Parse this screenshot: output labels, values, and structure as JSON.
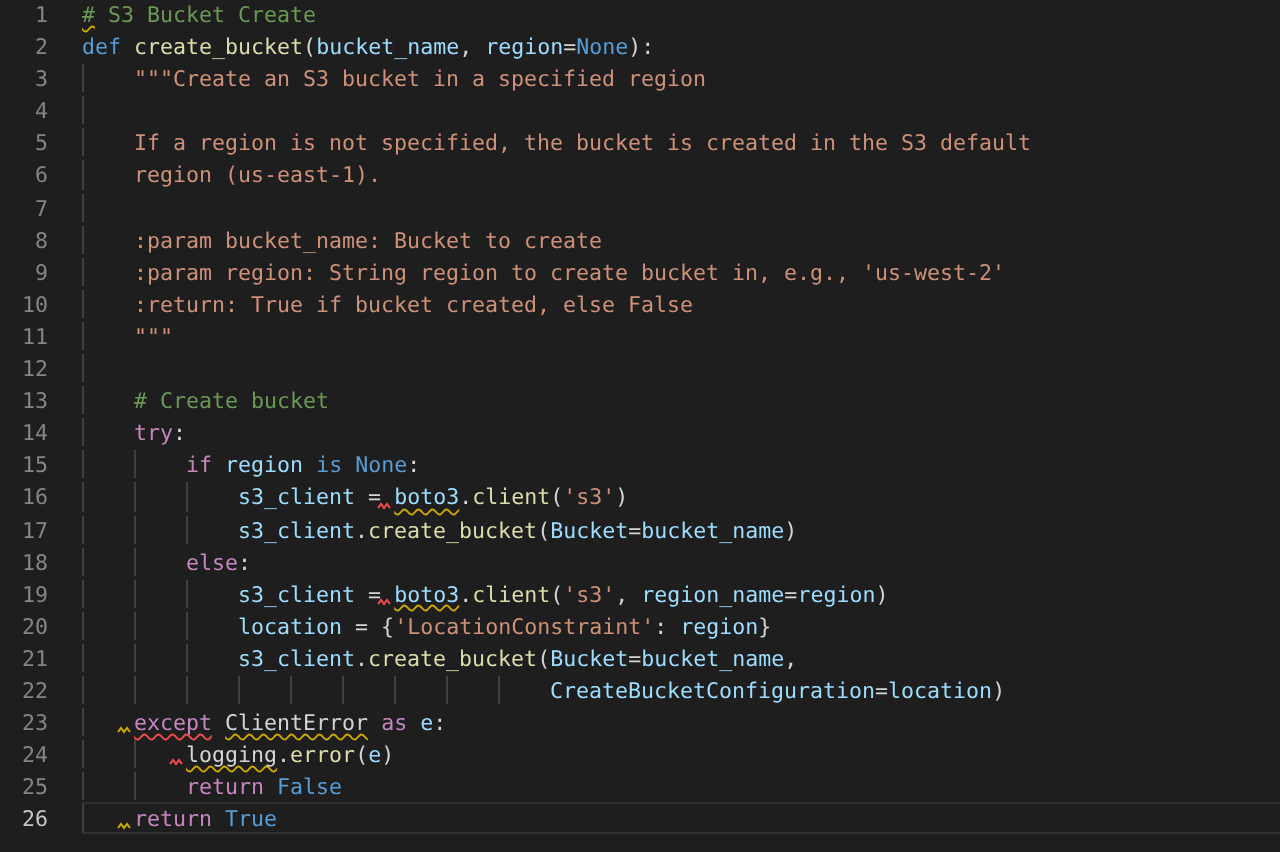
{
  "editor": {
    "lines": [
      {
        "number": "1",
        "current": false,
        "tokens": [
          {
            "kind": "cmt",
            "text": "#",
            "warning": true
          },
          {
            "kind": "cmt",
            "text": " S3 Bucket Create"
          }
        ]
      },
      {
        "number": "2",
        "current": false,
        "tokens": [
          {
            "kind": "kw",
            "text": "def"
          },
          {
            "kind": "fn",
            "text": " create_bucket"
          },
          {
            "kind": "punc",
            "text": "("
          },
          {
            "kind": "var",
            "text": "bucket_name"
          },
          {
            "kind": "punc",
            "text": ", "
          },
          {
            "kind": "var",
            "text": "region"
          },
          {
            "kind": "punc",
            "text": "="
          },
          {
            "kind": "kw",
            "text": "None"
          },
          {
            "kind": "punc",
            "text": "):"
          }
        ]
      },
      {
        "number": "3",
        "current": false,
        "tokens": [
          {
            "kind": "str",
            "text": "    \"\"\"Create an S3 bucket in a specified region"
          }
        ]
      },
      {
        "number": "4",
        "current": false
      },
      {
        "number": "5",
        "current": false,
        "tokens": [
          {
            "kind": "str",
            "text": "    If a region is not specified, the bucket is created in the S3 default"
          }
        ]
      },
      {
        "number": "6",
        "current": false,
        "tokens": [
          {
            "kind": "str",
            "text": "    region (us-east-1)."
          }
        ]
      },
      {
        "number": "7",
        "current": false
      },
      {
        "number": "8",
        "current": false,
        "tokens": [
          {
            "kind": "str",
            "text": "    :param bucket_name: Bucket to create"
          }
        ]
      },
      {
        "number": "9",
        "current": false,
        "tokens": [
          {
            "kind": "str",
            "text": "    :param region: String region to create bucket in, e.g., 'us-west-2'"
          }
        ]
      },
      {
        "number": "10",
        "current": false,
        "tokens": [
          {
            "kind": "str",
            "text": "    :return: True if bucket created, else False"
          }
        ]
      },
      {
        "number": "11",
        "current": false,
        "tokens": [
          {
            "kind": "str",
            "text": "    \"\"\""
          }
        ]
      },
      {
        "number": "12",
        "current": false
      },
      {
        "number": "13",
        "current": false,
        "tokens": [
          {
            "kind": "cmt",
            "text": "    # Create bucket"
          }
        ]
      },
      {
        "number": "14",
        "current": false,
        "tokens": [
          {
            "kind": "ctrl",
            "text": "    try"
          },
          {
            "kind": "punc",
            "text": ":"
          }
        ]
      },
      {
        "number": "15",
        "current": false,
        "tokens": [
          {
            "kind": "ctrl",
            "text": "        if"
          },
          {
            "kind": "var",
            "text": " region"
          },
          {
            "kind": "kw",
            "text": " is"
          },
          {
            "kind": "kw",
            "text": " None"
          },
          {
            "kind": "punc",
            "text": ":"
          }
        ]
      },
      {
        "number": "16",
        "current": false,
        "tokens": [
          {
            "kind": "var",
            "text": "            s3_client"
          },
          {
            "kind": "punc",
            "text": " = "
          },
          {
            "kind": "var",
            "text": "boto3",
            "warning": true,
            "lead_error": true
          },
          {
            "kind": "punc",
            "text": "."
          },
          {
            "kind": "fn",
            "text": "client"
          },
          {
            "kind": "punc",
            "text": "("
          },
          {
            "kind": "str",
            "text": "'s3'"
          },
          {
            "kind": "punc",
            "text": ")"
          }
        ]
      },
      {
        "number": "17",
        "current": false,
        "tokens": [
          {
            "kind": "var",
            "text": "            s3_client"
          },
          {
            "kind": "punc",
            "text": "."
          },
          {
            "kind": "fn",
            "text": "create_bucket"
          },
          {
            "kind": "punc",
            "text": "("
          },
          {
            "kind": "var",
            "text": "Bucket"
          },
          {
            "kind": "punc",
            "text": "="
          },
          {
            "kind": "var",
            "text": "bucket_name"
          },
          {
            "kind": "punc",
            "text": ")"
          }
        ]
      },
      {
        "number": "18",
        "current": false,
        "tokens": [
          {
            "kind": "ctrl",
            "text": "        else"
          },
          {
            "kind": "punc",
            "text": ":"
          }
        ]
      },
      {
        "number": "19",
        "current": false,
        "tokens": [
          {
            "kind": "var",
            "text": "            s3_client"
          },
          {
            "kind": "punc",
            "text": " = "
          },
          {
            "kind": "var",
            "text": "boto3",
            "warning": true,
            "lead_error": true
          },
          {
            "kind": "punc",
            "text": "."
          },
          {
            "kind": "fn",
            "text": "client"
          },
          {
            "kind": "punc",
            "text": "("
          },
          {
            "kind": "str",
            "text": "'s3'"
          },
          {
            "kind": "punc",
            "text": ", "
          },
          {
            "kind": "var",
            "text": "region_name"
          },
          {
            "kind": "punc",
            "text": "="
          },
          {
            "kind": "var",
            "text": "region"
          },
          {
            "kind": "punc",
            "text": ")"
          }
        ]
      },
      {
        "number": "20",
        "current": false,
        "tokens": [
          {
            "kind": "var",
            "text": "            location"
          },
          {
            "kind": "punc",
            "text": " = {"
          },
          {
            "kind": "str",
            "text": "'LocationConstraint'"
          },
          {
            "kind": "punc",
            "text": ": "
          },
          {
            "kind": "var",
            "text": "region"
          },
          {
            "kind": "punc",
            "text": "}"
          }
        ]
      },
      {
        "number": "21",
        "current": false,
        "tokens": [
          {
            "kind": "var",
            "text": "            s3_client"
          },
          {
            "kind": "punc",
            "text": "."
          },
          {
            "kind": "fn",
            "text": "create_bucket"
          },
          {
            "kind": "punc",
            "text": "("
          },
          {
            "kind": "var",
            "text": "Bucket"
          },
          {
            "kind": "punc",
            "text": "="
          },
          {
            "kind": "var",
            "text": "bucket_name"
          },
          {
            "kind": "punc",
            "text": ","
          }
        ]
      },
      {
        "number": "22",
        "current": false,
        "tokens": [
          {
            "kind": "var",
            "text": "                                    CreateBucketConfiguration"
          },
          {
            "kind": "punc",
            "text": "="
          },
          {
            "kind": "var",
            "text": "location"
          },
          {
            "kind": "punc",
            "text": ")"
          }
        ]
      },
      {
        "number": "23",
        "current": false,
        "tokens": [
          {
            "kind": "ctrl",
            "text": "    except",
            "error": true,
            "lead_warning": true
          },
          {
            "kind": "cls",
            "text": " ClientError",
            "warning": true
          },
          {
            "kind": "ctrl",
            "text": " as"
          },
          {
            "kind": "var",
            "text": " e"
          },
          {
            "kind": "punc",
            "text": ":"
          }
        ]
      },
      {
        "number": "24",
        "current": false,
        "tokens": [
          {
            "kind": "cls",
            "text": "        logging",
            "warning": true,
            "lead_error": true
          },
          {
            "kind": "punc",
            "text": "."
          },
          {
            "kind": "fn",
            "text": "error"
          },
          {
            "kind": "punc",
            "text": "("
          },
          {
            "kind": "var",
            "text": "e"
          },
          {
            "kind": "punc",
            "text": ")"
          }
        ]
      },
      {
        "number": "25",
        "current": false,
        "tokens": [
          {
            "kind": "ctrl",
            "text": "        return"
          },
          {
            "kind": "kw",
            "text": " False"
          }
        ]
      },
      {
        "number": "26",
        "current": true,
        "tokens": [
          {
            "kind": "ctrl",
            "text": "    return",
            "lead_warning": true
          },
          {
            "kind": "kw",
            "text": " True"
          }
        ]
      }
    ]
  }
}
